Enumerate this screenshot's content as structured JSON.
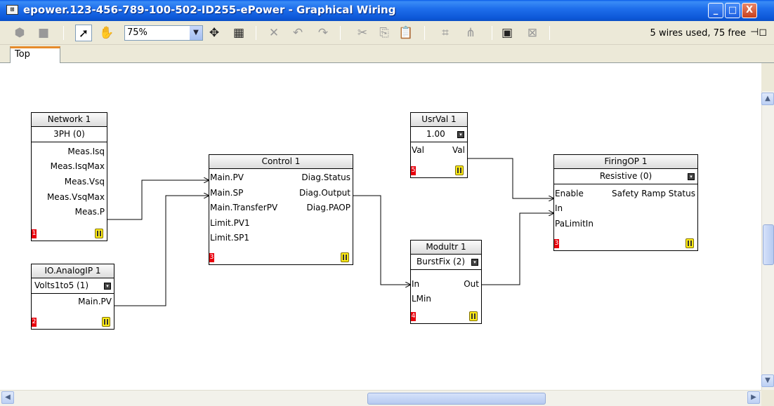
{
  "window": {
    "icon_label": "⊞",
    "title": "epower.123-456-789-100-502-ID255-ePower - Graphical Wiring",
    "btn_minimize": "_",
    "btn_maximize": "□",
    "btn_close": "X"
  },
  "toolbar": {
    "zoom_value": "75%",
    "status_text": "5 wires used, 75 free",
    "pin_glyph": "⊣◻"
  },
  "tabs": [
    "Top"
  ],
  "blocks": {
    "network": {
      "title": "Network 1",
      "subtitle": "3PH (0)",
      "outputs": [
        "Meas.Isq",
        "Meas.IsqMax",
        "Meas.Vsq",
        "Meas.VsqMax",
        "Meas.P"
      ],
      "order": "1"
    },
    "analogip": {
      "title": "IO.AnalogIP 1",
      "subtitle": "Volts1to5 (1)",
      "outputs": [
        "Main.PV"
      ],
      "order": "2"
    },
    "control": {
      "title": "Control 1",
      "inputs": [
        "Main.PV",
        "Main.SP",
        "Main.TransferPV",
        "Limit.PV1",
        "Limit.SP1"
      ],
      "outputs": [
        "Diag.Status",
        "Diag.Output",
        "Diag.PAOP"
      ],
      "order": "3"
    },
    "usrval": {
      "title": "UsrVal 1",
      "subtitle": "1.00",
      "input": "Val",
      "output": "Val",
      "order": "5"
    },
    "modultr": {
      "title": "Modultr 1",
      "subtitle": "BurstFix (2)",
      "inputs": [
        "In",
        "LMin"
      ],
      "output": "Out",
      "order": "4"
    },
    "firingop": {
      "title": "FiringOP 1",
      "subtitle": "Resistive (0)",
      "inputs": [
        "Enable",
        "In",
        "PaLimitIn"
      ],
      "output": "Safety Ramp Status",
      "order": "3"
    }
  },
  "colors": {
    "titlebar": "#0a5ce8",
    "tab_accent": "#e68b2c",
    "order_badge": "#e8000c",
    "exec_icon": "#ffec18"
  }
}
